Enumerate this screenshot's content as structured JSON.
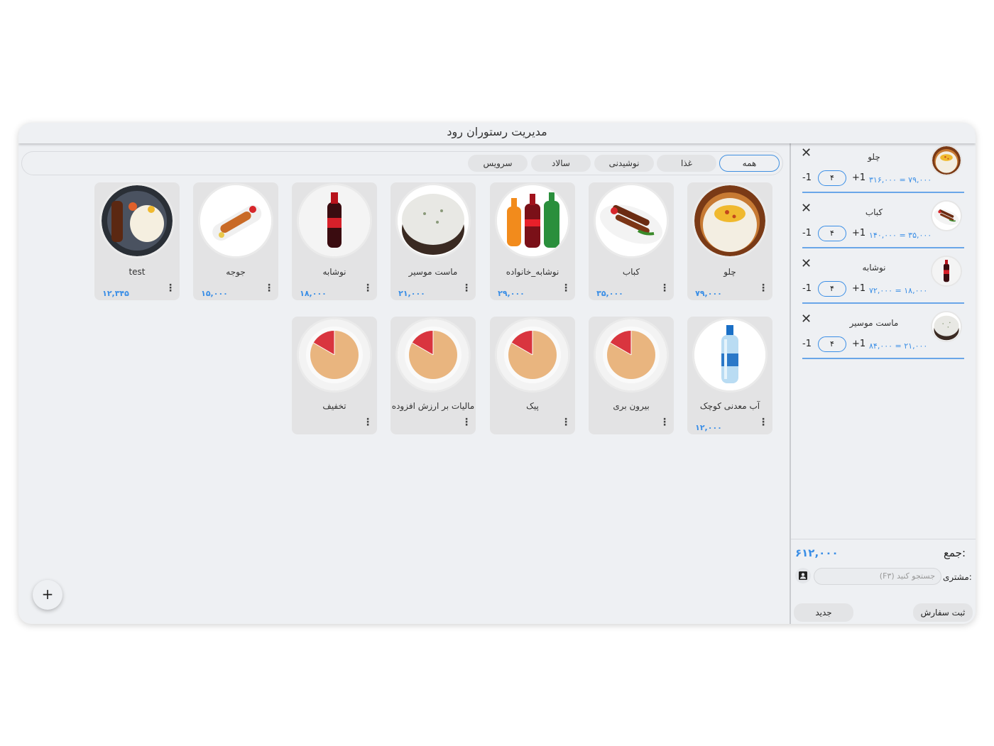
{
  "app": {
    "title": "مدیریت رستوران رود"
  },
  "tabs": [
    "همه",
    "غذا",
    "نوشیدنی",
    "سالاد",
    "سرویس"
  ],
  "products": [
    {
      "name": "چلو",
      "price": "۷۹,۰۰۰",
      "image": "rice"
    },
    {
      "name": "کباب",
      "price": "۳۵,۰۰۰",
      "image": "kebab"
    },
    {
      "name": "نوشابه_خانواده",
      "price": "۲۹,۰۰۰",
      "image": "bottles"
    },
    {
      "name": "ماست موسیر",
      "price": "۲۱,۰۰۰",
      "image": "yogurt"
    },
    {
      "name": "نوشابه",
      "price": "۱۸,۰۰۰",
      "image": "cola"
    },
    {
      "name": "جوجه",
      "price": "۱۵,۰۰۰",
      "image": "joojeh"
    },
    {
      "name": "test",
      "price": "۱۲,۳۴۵",
      "image": "platter"
    },
    {
      "name": "آب معدنی کوچک",
      "price": "۱۲,۰۰۰",
      "image": "water"
    },
    {
      "name": "بیرون بری",
      "price": "",
      "image": "pie"
    },
    {
      "name": "پیک",
      "price": "",
      "image": "pie"
    },
    {
      "name": "مالیات بر ارزش افزوده",
      "price": "",
      "image": "pie"
    },
    {
      "name": "تخفیف",
      "price": "",
      "image": "pie"
    }
  ],
  "order": [
    {
      "name": "چلو",
      "qty": "۴",
      "calc": "۷۹,۰۰۰ = ۳۱۶,۰۰۰",
      "image": "rice"
    },
    {
      "name": "کباب",
      "qty": "۴",
      "calc": "۳۵,۰۰۰ = ۱۴۰,۰۰۰",
      "image": "kebab"
    },
    {
      "name": "نوشابه",
      "qty": "۴",
      "calc": "۱۸,۰۰۰ = ۷۲,۰۰۰",
      "image": "cola"
    },
    {
      "name": "ماست موسیر",
      "qty": "۴",
      "calc": "۲۱,۰۰۰ = ۸۴,۰۰۰",
      "image": "yogurt"
    }
  ],
  "controls": {
    "close": "✕",
    "minus": "-1",
    "plus": "+1",
    "menu": "⋮",
    "fab": "+"
  },
  "footer": {
    "total_label": "جمع:",
    "total_value": "۶۱۲,۰۰۰",
    "customer_label": "مشتری:",
    "customer_placeholder": "جستجو کنید (F۳)",
    "submit_label": "ثبت سفارش",
    "new_label": "جدید"
  },
  "colors": {
    "accent": "#3a8ee6",
    "pie_fill": "#e9b57f",
    "pie_slice": "#d9353f"
  }
}
